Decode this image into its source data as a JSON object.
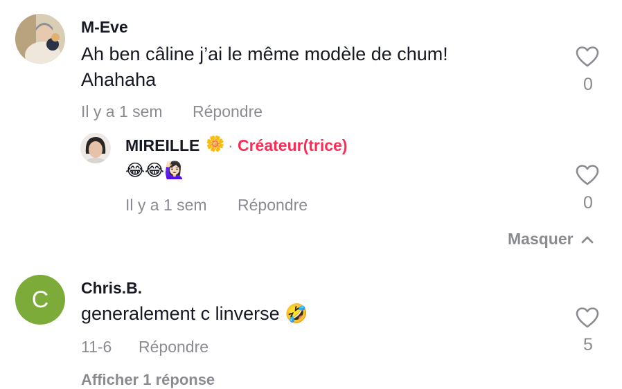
{
  "comments": [
    {
      "username": "M-Eve",
      "text_line1": "Ah ben câline j’ai le même modèle de chum!",
      "text_line2": "Ahahaha",
      "time": "Il y a 1 sem",
      "reply_label": "Répondre",
      "likes": "0"
    },
    {
      "username": "MIREILLE",
      "name_emoji": "🌼",
      "separator": "·",
      "badge": "Créateur(trice)",
      "text": "😂😂🙋🏻‍♀️",
      "time": "Il y a 1 sem",
      "reply_label": "Répondre",
      "likes": "0"
    },
    {
      "username": "Chris.B.",
      "avatar_letter": "C",
      "avatar_color": "#7cab3a",
      "text": "generalement c linverse 🤣",
      "time": "11-6",
      "reply_label": "Répondre",
      "likes": "5"
    }
  ],
  "hide_label": "Masquer",
  "show_replies_label": "Afficher 1 réponse",
  "colors": {
    "accent": "#fe2c55",
    "muted": "#8a8b91",
    "text": "#161823"
  },
  "icons": {
    "like": "heart-outline-icon",
    "hide": "chevron-up-icon"
  }
}
